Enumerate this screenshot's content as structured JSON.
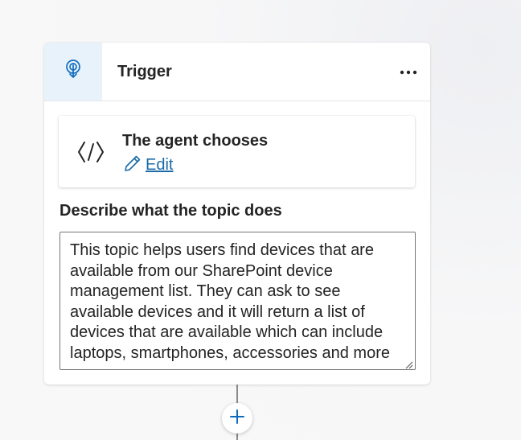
{
  "trigger_card": {
    "title": "Trigger",
    "header_icon": "trigger-pin-icon",
    "more_icon": "more-horizontal-icon",
    "more_label": "More options"
  },
  "agent_selection": {
    "label": "The agent chooses",
    "icon": "code-brackets-icon",
    "edit": {
      "icon": "pencil-icon",
      "label": "Edit"
    }
  },
  "description": {
    "label": "Describe what the topic does",
    "value": "This topic helps users find devices that are available from our SharePoint device management list. They can ask to see available devices and it will return a list of devices that are available which can include laptops, smartphones, accessories and more"
  },
  "add_step": {
    "icon": "plus-icon"
  },
  "colors": {
    "accent": "#1a6ba8",
    "icon_blue": "#0f6cbd",
    "header_icon_bg": "#e8f2fb",
    "canvas": "#f7f7f8"
  }
}
